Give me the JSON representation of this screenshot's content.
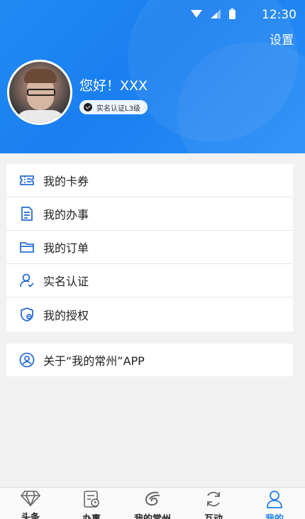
{
  "status_bar": {
    "time": "12:30"
  },
  "header": {
    "settings_label": "设置",
    "greeting": "您好！XXX",
    "verify_badge": "实名认证L3级"
  },
  "menu": [
    {
      "label": "我的卡券",
      "icon": "ticket-icon"
    },
    {
      "label": "我的办事",
      "icon": "document-icon"
    },
    {
      "label": "我的订单",
      "icon": "folder-icon"
    },
    {
      "label": "实名认证",
      "icon": "user-check-icon"
    },
    {
      "label": "我的授权",
      "icon": "shield-icon"
    }
  ],
  "about": {
    "label": "关于“我的常州”APP",
    "icon": "user-circle-icon"
  },
  "tabs": [
    {
      "label": "头条",
      "icon": "diamond-icon",
      "active": false
    },
    {
      "label": "办事",
      "icon": "service-icon",
      "active": false
    },
    {
      "label": "我的常州",
      "icon": "city-logo-icon",
      "active": false
    },
    {
      "label": "互动",
      "icon": "refresh-icon",
      "active": false
    },
    {
      "label": "我的",
      "icon": "person-icon",
      "active": true
    }
  ],
  "colors": {
    "primary": "#1a7ff0",
    "icon_blue": "#2a6fd6",
    "background": "#f2f2f2"
  }
}
